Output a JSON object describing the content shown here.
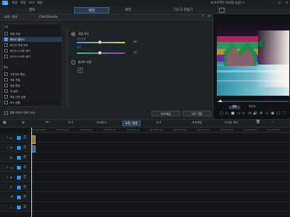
{
  "app": {
    "menu": [
      "파일",
      "편집",
      "보기",
      "재생"
    ],
    "title": "새 프로젝트 (미저장 없음) +"
  },
  "mode_tabs": [
    "캡처",
    "편집",
    "제작",
    "디스크 만들기"
  ],
  "panel": {
    "tabs": [
      "교정 / 향상",
      "ColorDirector"
    ],
    "groups": [
      {
        "title": "수정",
        "items": [
          {
            "label": "조명 조정",
            "checked": false,
            "selected": false
          },
          {
            "label": "화이트 밸런스",
            "checked": true,
            "selected": true
          },
          {
            "label": "비디오 안정 장치",
            "checked": false,
            "selected": false
          },
          {
            "label": "비디오 노이즈 제거",
            "checked": false,
            "selected": false
          },
          {
            "label": "오디오 노이즈 제거",
            "checked": false,
            "selected": false
          }
        ]
      },
      {
        "title": "향상",
        "items": [
          {
            "label": "가장자리 향상",
            "checked": false,
            "selected": false
          },
          {
            "label": "색상 조절",
            "checked": false,
            "selected": false
          },
          {
            "label": "영상 향상",
            "checked": false,
            "selected": false
          },
          {
            "label": "색 일치",
            "checked": false,
            "selected": false
          },
          {
            "label": "색상 사전 설정",
            "checked": false,
            "selected": false
          },
          {
            "label": "포스 분할",
            "checked": false,
            "selected": false
          }
        ]
      }
    ],
    "color_temp": {
      "label": "색상 온도",
      "value": "50",
      "track_color": "#e3d31a"
    },
    "tint": {
      "label": "색조",
      "value": "50",
      "track_color": "#9a3ad0"
    },
    "white_calibration": {
      "label": "화이트 보정"
    },
    "compare_label": "분할 미리보기에서 비교",
    "keyframe_btn": "키프레임",
    "apply_all_btn": "모두 적용"
  },
  "preview": {
    "modes": [
      "클립",
      "동영상"
    ],
    "controls": [
      "▢",
      "▷",
      "■",
      "◁",
      "▷",
      "◷",
      "🔊",
      "⚙",
      "▭",
      "▣",
      "▢",
      "◲",
      "⛶"
    ]
  },
  "timeline": {
    "tools": [
      "도구",
      "디자이너",
      "교정 / 향상",
      "도구",
      "키프레임",
      "오디오 믹서"
    ],
    "ruler": [
      "00:00:00:00",
      "00:01:40:03",
      "00:03:20:06",
      "00:05:00:10",
      "00:06:40:13",
      "00:08:20:16",
      "00:10:00:20",
      "00:11:40:23",
      "00:13:20:26",
      "00:15:00:30",
      "00:16:40:33"
    ],
    "tracks": [
      {
        "index": "1.",
        "icon": "video-track-icon",
        "glyph": "▭"
      },
      {
        "index": "1.",
        "icon": "audio-track-icon",
        "glyph": "◂)"
      },
      {
        "index": "",
        "icon": "fx-track-icon",
        "glyph": "fx"
      },
      {
        "index": "2.",
        "icon": "video-track-icon",
        "glyph": "▭"
      },
      {
        "index": "2.",
        "icon": "audio-track-icon",
        "glyph": "◂)"
      },
      {
        "index": "",
        "icon": "title-track-icon",
        "glyph": "T"
      },
      {
        "index": "",
        "icon": "voice-track-icon",
        "glyph": "🎤"
      },
      {
        "index": "",
        "icon": "music-track-icon",
        "glyph": "♪"
      }
    ]
  }
}
